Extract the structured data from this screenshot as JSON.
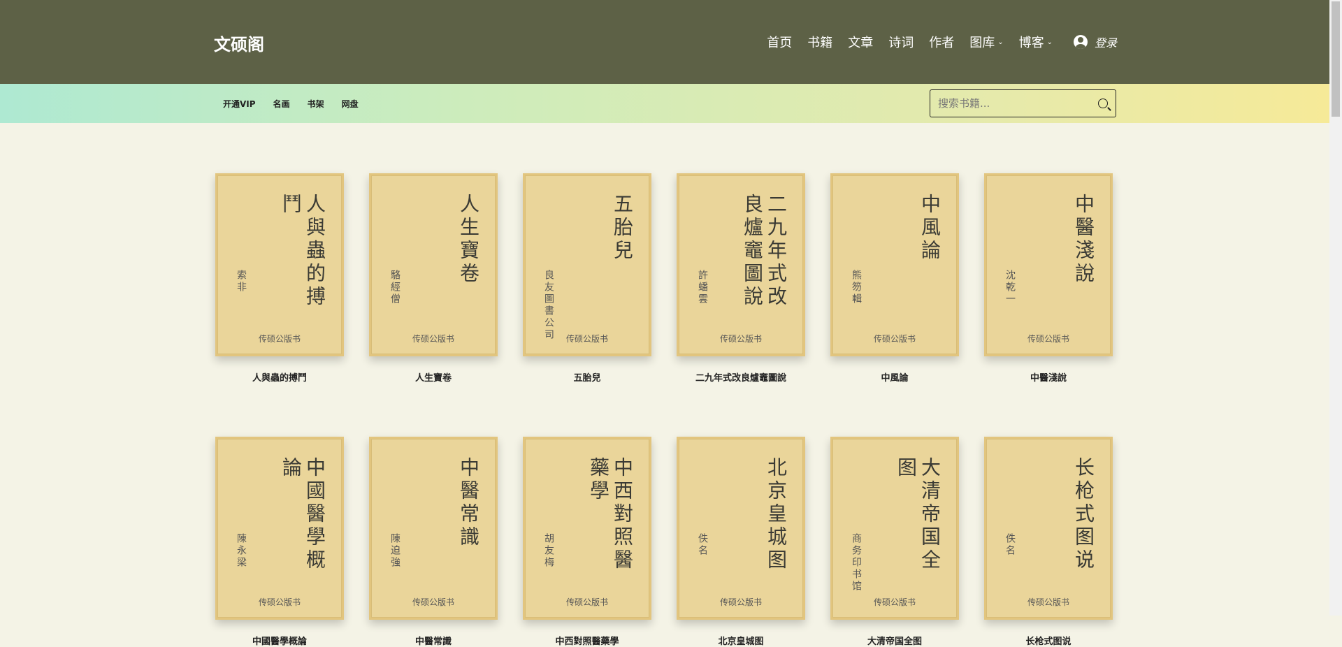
{
  "header": {
    "logo": "文硕阁",
    "nav": [
      "首页",
      "书籍",
      "文章",
      "诗词",
      "作者"
    ],
    "nav_dropdowns": [
      "图库",
      "博客"
    ],
    "login": "登录"
  },
  "subnav": {
    "links": [
      "开通VIP",
      "名画",
      "书架",
      "网盘"
    ],
    "search_placeholder": "搜索书籍..."
  },
  "books": [
    {
      "title": "人與蟲的搏鬥",
      "author": "索非",
      "publisher": "传硕公版书"
    },
    {
      "title": "人生寶卷",
      "author": "駱經僧",
      "publisher": "传硕公版书"
    },
    {
      "title": "五胎兒",
      "author": "良友圖書公司",
      "publisher": "传硕公版书"
    },
    {
      "title": "二九年式改良爐竈圖說",
      "author": "許蟠雲",
      "publisher": "传硕公版书"
    },
    {
      "title": "中風論",
      "author": "熊笏輯",
      "publisher": "传硕公版书"
    },
    {
      "title": "中醫淺說",
      "author": "沈乾一",
      "publisher": "传硕公版书"
    },
    {
      "title": "中國醫學概論",
      "author": "陳永梁",
      "publisher": "传硕公版书"
    },
    {
      "title": "中醫常識",
      "author": "陳迫強",
      "publisher": "传硕公版书"
    },
    {
      "title": "中西對照醫藥學",
      "author": "胡友梅",
      "publisher": "传硕公版书"
    },
    {
      "title": "北京皇城图",
      "author": "佚名",
      "publisher": "传硕公版书"
    },
    {
      "title": "大清帝国全图",
      "author": "商务印书馆",
      "publisher": "传硕公版书"
    },
    {
      "title": "长枪式图说",
      "author": "佚名",
      "publisher": "传硕公版书"
    }
  ]
}
